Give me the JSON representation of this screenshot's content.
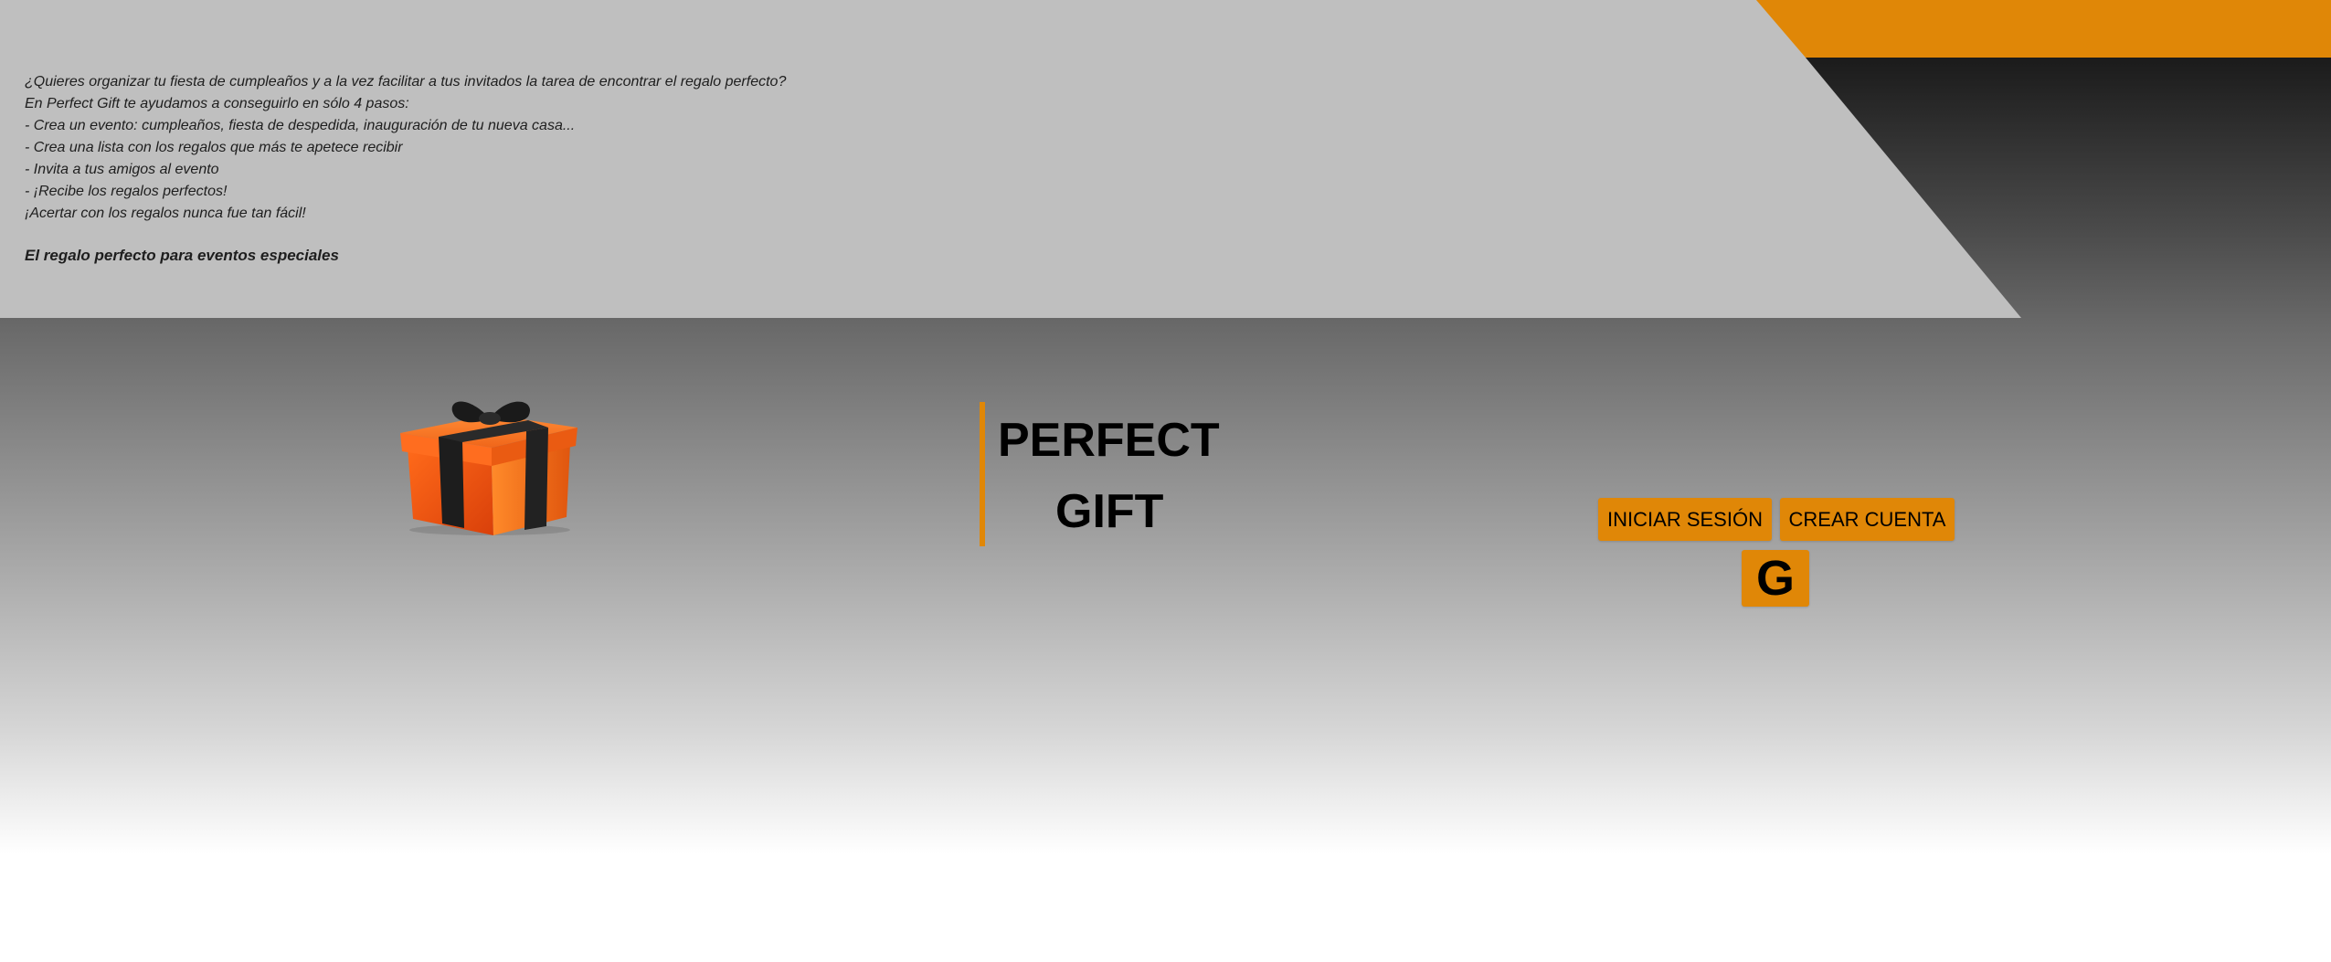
{
  "intro": {
    "lines": [
      "¿Quieres organizar tu fiesta de cumpleaños y a la vez facilitar a tus invitados la tarea de encontrar el regalo perfecto?",
      "En Perfect Gift te ayudamos a conseguirlo en sólo 4 pasos:",
      "- Crea un evento: cumpleaños, fiesta de despedida, inauguración de tu nueva casa...",
      "- Crea una lista con los regalos que más te apetece recibir",
      "- Invita a tus amigos al evento",
      "- ¡Recibe los regalos perfectos!",
      "¡Acertar con los regalos nunca fue tan fácil!"
    ],
    "tagline": "El regalo perfecto para eventos especiales"
  },
  "brand": {
    "line1": "PERFECT",
    "line2": "GIFT"
  },
  "auth": {
    "login_label": "INICIAR SESIÓN",
    "signup_label": "CREAR CUENTA",
    "google_label": "G"
  },
  "icons": {
    "logo": "gift-box-icon",
    "google": "google-icon"
  },
  "colors": {
    "accent": "#e08707",
    "panel": "#bfbfbf",
    "text": "#1e1e1e"
  }
}
